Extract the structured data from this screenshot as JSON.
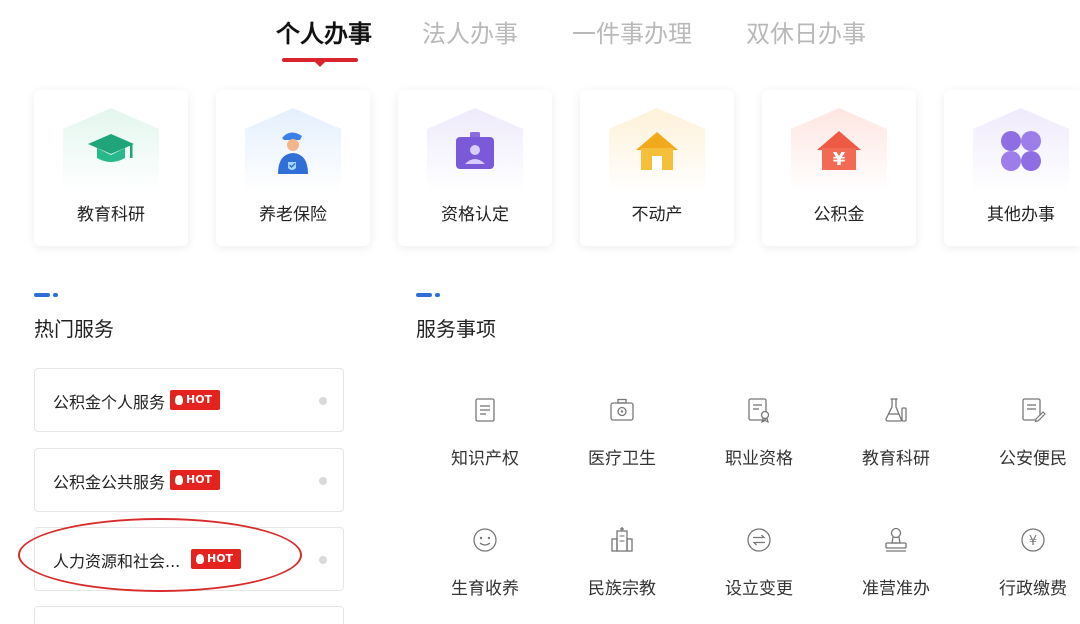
{
  "tabs": [
    {
      "label": "个人办事",
      "active": true
    },
    {
      "label": "法人办事",
      "active": false
    },
    {
      "label": "一件事办理",
      "active": false
    },
    {
      "label": "双休日办事",
      "active": false
    }
  ],
  "categories": [
    {
      "label": "教育科研",
      "icon": "graduation-cap-icon"
    },
    {
      "label": "养老保险",
      "icon": "elderly-person-icon"
    },
    {
      "label": "资格认定",
      "icon": "id-badge-icon"
    },
    {
      "label": "不动产",
      "icon": "house-icon"
    },
    {
      "label": "公积金",
      "icon": "yuan-house-icon"
    },
    {
      "label": "其他办事",
      "icon": "grid-icon"
    }
  ],
  "hot_services": {
    "title": "热门服务",
    "badge": "HOT",
    "items": [
      {
        "label": "公积金个人服务"
      },
      {
        "label": "公积金公共服务"
      },
      {
        "label": "人力资源和社会..."
      }
    ]
  },
  "service_items": {
    "title": "服务事项",
    "items": [
      {
        "label": "知识产权",
        "icon": "document-icon"
      },
      {
        "label": "医疗卫生",
        "icon": "medical-kit-icon"
      },
      {
        "label": "职业资格",
        "icon": "certificate-icon"
      },
      {
        "label": "教育科研",
        "icon": "lab-flask-icon"
      },
      {
        "label": "公安便民",
        "icon": "form-edit-icon"
      },
      {
        "label": "生育收养",
        "icon": "smiley-icon"
      },
      {
        "label": "民族宗教",
        "icon": "building-icon"
      },
      {
        "label": "设立变更",
        "icon": "exchange-icon"
      },
      {
        "label": "准营准办",
        "icon": "stamp-icon"
      },
      {
        "label": "行政缴费",
        "icon": "yuan-coin-icon"
      }
    ]
  },
  "colors": {
    "accent_red": "#d8242c",
    "section_blue": "#2e6ed8"
  }
}
